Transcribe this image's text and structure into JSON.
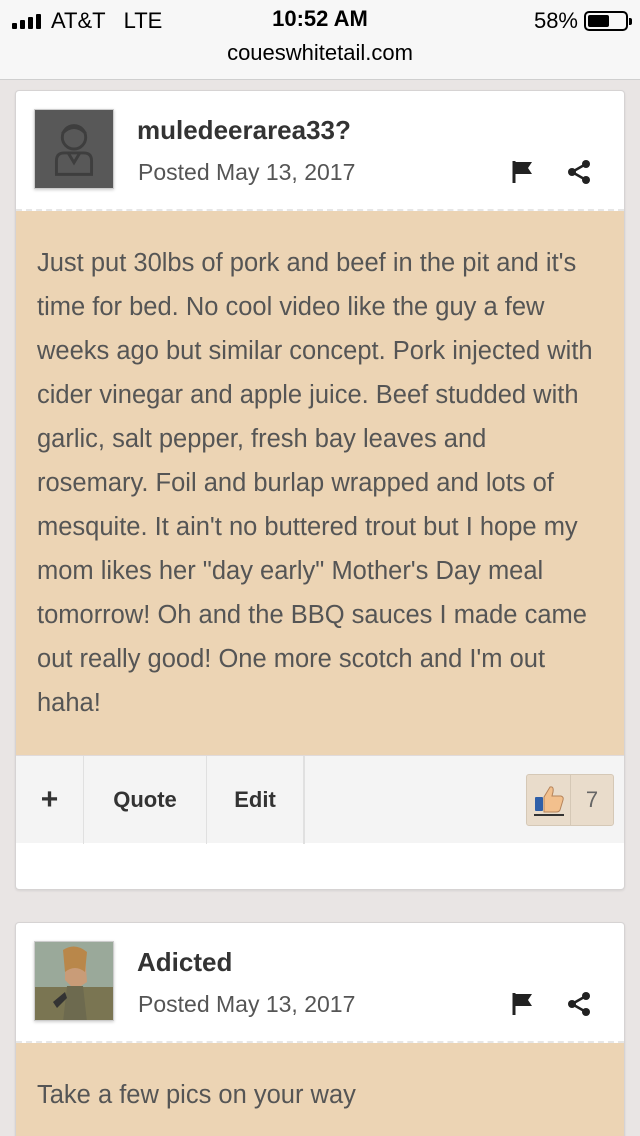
{
  "status_bar": {
    "carrier": "AT&T",
    "network": "LTE",
    "time": "10:52 AM",
    "battery_percent": "58%",
    "battery_level": 0.58
  },
  "browser": {
    "url": "coueswhitetail.com"
  },
  "posts": [
    {
      "author": "muledeerarea33?",
      "posted": "Posted May 13, 2017",
      "body": "Just put 30lbs of pork and beef in the pit and it's time for bed. No cool video like the guy a few weeks ago but similar concept. Pork injected with cider vinegar and apple juice. Beef studded with garlic, salt pepper, fresh bay leaves and rosemary. Foil and burlap wrapped and lots of mesquite. It ain't no buttered trout but I hope my mom likes her \"day early\" Mother's Day meal tomorrow! Oh and the BBQ sauces I made came out really good! One more scotch and I'm out haha!",
      "actions": {
        "plus": "+",
        "quote": "Quote",
        "edit": "Edit"
      },
      "reaction_count": "7"
    },
    {
      "author": "Adicted",
      "posted": "Posted May 13, 2017",
      "body": "Take a few pics on your way"
    }
  ],
  "colors": {
    "body_bg": "#ecd4b4",
    "page_bg": "#e9e5e4"
  },
  "icons": [
    "flag-icon",
    "share-icon",
    "thumbs-up-icon",
    "default-avatar-icon"
  ]
}
